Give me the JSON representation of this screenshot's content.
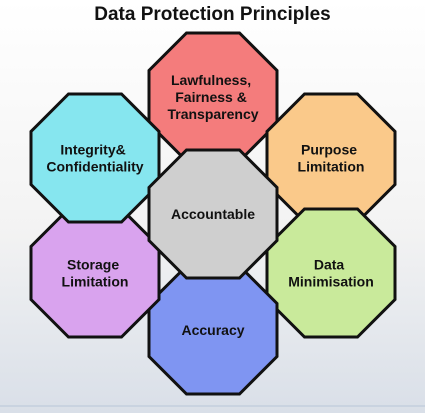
{
  "title": "Data Protection Principles",
  "principles": [
    {
      "id": "lawfulness",
      "lines": [
        "Lawfulness,",
        "Fairness &",
        "Transparency"
      ],
      "fill": "#f47c7c"
    },
    {
      "id": "purpose",
      "lines": [
        "Purpose",
        "Limitation"
      ],
      "fill": "#fac98a"
    },
    {
      "id": "minimisation",
      "lines": [
        "Data",
        "Minimisation"
      ],
      "fill": "#c9ea9b"
    },
    {
      "id": "accuracy",
      "lines": [
        "Accuracy"
      ],
      "fill": "#7f95f2"
    },
    {
      "id": "storage",
      "lines": [
        "Storage",
        "Limitation"
      ],
      "fill": "#d9a3ee"
    },
    {
      "id": "integrity",
      "lines": [
        "Integrity&",
        "Confidentiality"
      ],
      "fill": "#86e6ef"
    },
    {
      "id": "accountable",
      "lines": [
        "Accountable"
      ],
      "fill": "#cfcfcf"
    }
  ]
}
